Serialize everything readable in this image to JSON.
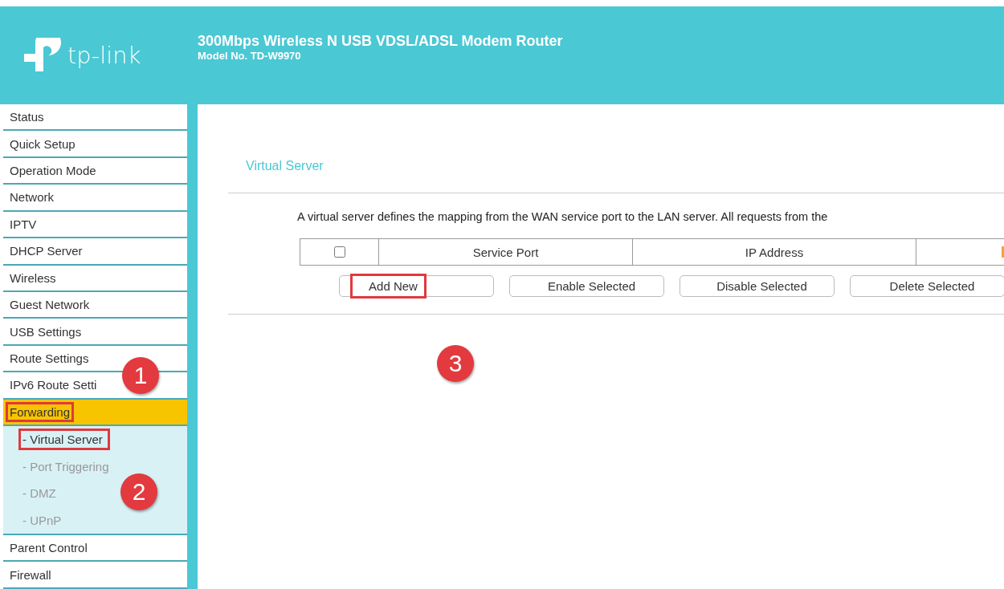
{
  "header": {
    "logo": "tp-link",
    "title": "300Mbps Wireless N USB VDSL/ADSL Modem Router",
    "model": "Model No. TD-W9970"
  },
  "sidebar": {
    "items": [
      {
        "label": "Status",
        "selected": false,
        "highlighted": false
      },
      {
        "label": "Quick Setup",
        "selected": false,
        "highlighted": false
      },
      {
        "label": "Operation Mode",
        "selected": false,
        "highlighted": false
      },
      {
        "label": "Network",
        "selected": false,
        "highlighted": false
      },
      {
        "label": "IPTV",
        "selected": false,
        "highlighted": false
      },
      {
        "label": "DHCP Server",
        "selected": false,
        "highlighted": false
      },
      {
        "label": "Wireless",
        "selected": false,
        "highlighted": false
      },
      {
        "label": "Guest Network",
        "selected": false,
        "highlighted": false
      },
      {
        "label": "USB Settings",
        "selected": false,
        "highlighted": false
      },
      {
        "label": "Route Settings",
        "selected": false,
        "highlighted": false
      },
      {
        "label": "IPv6 Route Setti",
        "selected": false,
        "highlighted": false
      },
      {
        "label": "Forwarding",
        "selected": true,
        "highlighted": true,
        "children": [
          {
            "label": "- Virtual Server",
            "selected": true,
            "highlighted": true
          },
          {
            "label": "- Port Triggering",
            "selected": false,
            "highlighted": false
          },
          {
            "label": "- DMZ",
            "selected": false,
            "highlighted": false
          },
          {
            "label": "- UPnP",
            "selected": false,
            "highlighted": false
          }
        ]
      },
      {
        "label": "Parent Control",
        "selected": false,
        "highlighted": false
      },
      {
        "label": "Firewall",
        "selected": false,
        "highlighted": false
      }
    ]
  },
  "page": {
    "title": "Virtual Server",
    "description": "A virtual server defines the mapping from the WAN service port to the LAN server. All requests from the",
    "table": {
      "header_checkbox": {
        "checked": false
      },
      "columns": [
        "Service Port",
        "IP Address"
      ]
    },
    "buttons": [
      {
        "label": "Add New",
        "highlighted": true
      },
      {
        "label": "Enable Selected",
        "highlighted": false
      },
      {
        "label": "Disable Selected",
        "highlighted": false
      },
      {
        "label": "Delete Selected",
        "highlighted": false
      }
    ]
  },
  "callouts": [
    "1",
    "2",
    "3"
  ]
}
